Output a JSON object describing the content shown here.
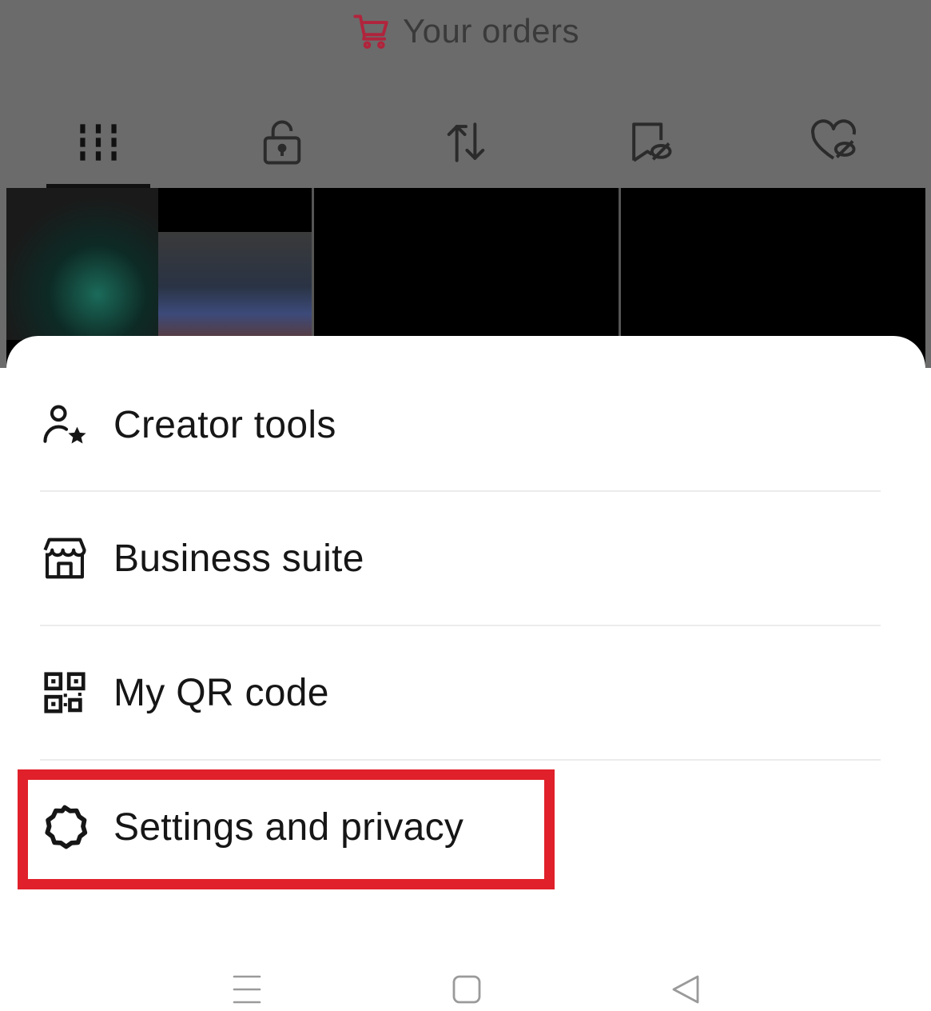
{
  "background": {
    "orders_label": "Your orders",
    "tabs": [
      {
        "icon": "grid-bars-icon",
        "active": true
      },
      {
        "icon": "lock-icon",
        "active": false
      },
      {
        "icon": "repost-icon",
        "active": false
      },
      {
        "icon": "hidden-bookmark-icon",
        "active": false
      },
      {
        "icon": "hidden-heart-icon",
        "active": false
      }
    ]
  },
  "menu": {
    "items": [
      {
        "label": "Creator tools",
        "icon": "person-star-icon"
      },
      {
        "label": "Business suite",
        "icon": "storefront-icon"
      },
      {
        "label": "My QR code",
        "icon": "qr-code-icon"
      },
      {
        "label": "Settings and privacy",
        "icon": "gear-icon",
        "highlighted": true
      }
    ]
  },
  "colors": {
    "highlight": "#e0202a",
    "cart_icon": "#c2185b",
    "overlay": "#6b6b6b"
  },
  "navbar": {
    "buttons": [
      "menu-icon",
      "home-square-icon",
      "back-triangle-icon"
    ]
  }
}
